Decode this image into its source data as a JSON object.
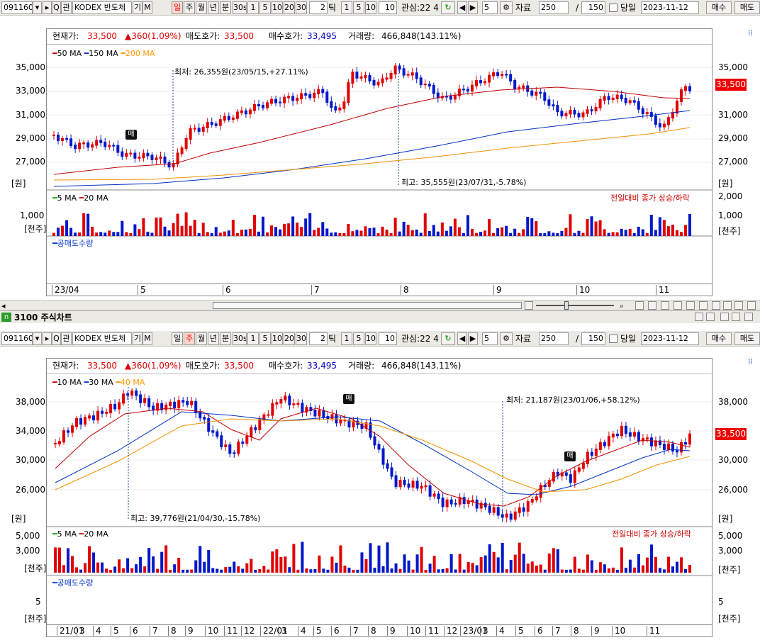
{
  "toolbar1": {
    "code": "091160",
    "dropdown": "▾",
    "play": "▸",
    "search": "Q",
    "gwan": "관",
    "name": "KODEX 반도체",
    "gi": "기",
    "m": "M",
    "periods": [
      "일",
      "주",
      "월",
      "년",
      "분"
    ],
    "active_period": 0,
    "min_sel": "30s",
    "nums1": [
      "1",
      "5",
      "10",
      "20",
      "30"
    ],
    "tick_val": "2",
    "tick_label": "틱",
    "nums2": [
      "1",
      "5",
      "10"
    ],
    "nums2_val": "10",
    "gwansim": "관심:22 4",
    "nav_val": "5",
    "jaryo_label": "자료",
    "jaryo_val": "250",
    "slash": "/",
    "count": "150",
    "dangil": "당일",
    "date": "2023-11-12",
    "buy": "매수",
    "sell": "매도"
  },
  "toolbar2": {
    "code": "091160",
    "dropdown": "▾",
    "play": "▸",
    "search": "Q",
    "gwan": "관",
    "name": "KODEX 반도체",
    "gi": "기",
    "m": "M",
    "periods": [
      "일",
      "주",
      "월",
      "년",
      "분"
    ],
    "active_period": 1,
    "min_sel": "30s",
    "nums1": [
      "1",
      "5",
      "10",
      "20",
      "30"
    ],
    "tick_val": "2",
    "tick_label": "틱",
    "nums2": [
      "1",
      "5",
      "10"
    ],
    "nums2_val": "10",
    "gwansim": "관심:22 4",
    "nav_val": "5",
    "jaryo_label": "자료",
    "jaryo_val": "250",
    "slash": "/",
    "count": "150",
    "dangil": "당일",
    "date": "2023-11-12",
    "buy": "매수",
    "sell": "매도"
  },
  "window2_title": "3100 주식차트",
  "info": {
    "price_label": "현재가:",
    "price": "33,500",
    "change": "▲360(1.09%)",
    "ask_label": "매도호가:",
    "ask": "33,500",
    "bid_label": "매수호가:",
    "bid": "33,495",
    "vol_label": "거래량:",
    "vol": "466,848(143.11%)"
  },
  "chart1": {
    "ma_legend": [
      {
        "name": "50 MA",
        "color": "#c00000"
      },
      {
        "name": "150 MA",
        "color": "#0030c0"
      },
      {
        "name": "200 MA",
        "color": "#f09000"
      }
    ],
    "y_ticks": [
      "35,000",
      "33,000",
      "31,000",
      "29,000",
      "27,000"
    ],
    "y_unit": "[원]",
    "price_tag": "33,500",
    "low_note": "최저: 26,355원(23/05/15,+27.11%)",
    "high_note": "최고: 35,555원(23/07/31,-5.78%)",
    "vol_legend": [
      {
        "name": "5 MA",
        "color": "#00a000"
      },
      {
        "name": "20 MA",
        "color": "#c00000"
      }
    ],
    "vol_right": "전일대비 종가 상승/하락",
    "vol_ticks": [
      "2,000",
      "1,000"
    ],
    "vol_unit": "[천주]",
    "short_legend": "공매도수량",
    "x_labels": [
      "23/04",
      "5",
      "6",
      "7",
      "8",
      "9",
      "10",
      "11"
    ],
    "marker": "매"
  },
  "chart2": {
    "ma_legend": [
      {
        "name": "10 MA",
        "color": "#c00000"
      },
      {
        "name": "30 MA",
        "color": "#0030c0"
      },
      {
        "name": "40 MA",
        "color": "#f09000"
      }
    ],
    "y_ticks": [
      "38,000",
      "34,000",
      "30,000",
      "26,000"
    ],
    "y_unit": "[원]",
    "price_tag": "33,500",
    "low_note": "최저: 21,187원(23/01/06,+58.12%)",
    "high_note": "최고: 39,776원(21/04/30,-15.78%)",
    "vol_legend": [
      {
        "name": "5 MA",
        "color": "#00a000"
      },
      {
        "name": "20 MA",
        "color": "#c00000"
      }
    ],
    "vol_right": "전일대비 종가 상승/하락",
    "vol_ticks": [
      "5,000",
      "3,000"
    ],
    "vol_unit": "[천주]",
    "short_legend": "공매도수량",
    "short_ticks": [
      "5",
      "5"
    ],
    "x_labels": [
      "21/01",
      "3",
      "4",
      "5",
      "6",
      "7",
      "8",
      "9",
      "10",
      "11",
      "12",
      "22/01",
      "3",
      "4",
      "5",
      "6",
      "7",
      "8",
      "9",
      "10",
      "11",
      "12",
      "23/01",
      "3",
      "4",
      "5",
      "6",
      "7",
      "8",
      "9",
      "10",
      "11"
    ],
    "marker": "매"
  }
}
